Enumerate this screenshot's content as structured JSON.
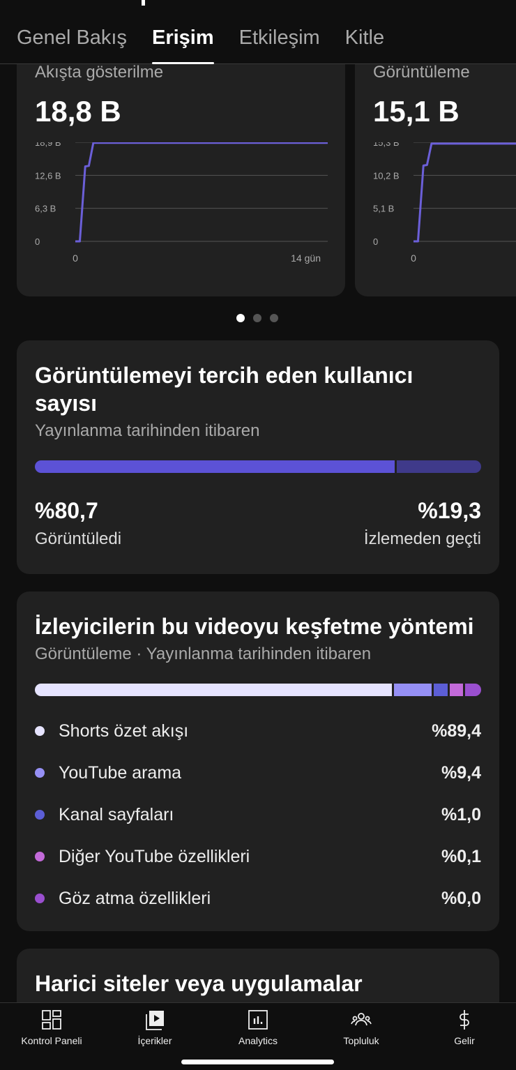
{
  "tabs": [
    {
      "label": "Genel Bakış"
    },
    {
      "label": "Erişim",
      "active": true
    },
    {
      "label": "Etkileşim"
    },
    {
      "label": "Kitle"
    }
  ],
  "chart_data": [
    {
      "type": "line",
      "title": "Akışta gösterilme",
      "value_label": "18,8 B",
      "yticks": [
        "0",
        "6,3 B",
        "12,6 B",
        "18,9 B"
      ],
      "ytick_values": [
        0,
        6.3,
        12.6,
        18.9
      ],
      "xticks": [
        "0",
        "14 gün"
      ],
      "xtick_values": [
        0,
        14
      ],
      "ylim": [
        0,
        18.9
      ],
      "xlim": [
        0,
        14
      ],
      "grid": true,
      "color": "#6b5fd8",
      "x": [
        0,
        0.25,
        0.55,
        0.75,
        1.0,
        14
      ],
      "y": [
        0,
        0,
        14.3,
        14.4,
        18.8,
        18.8
      ]
    },
    {
      "type": "line",
      "title": "Görüntüleme",
      "value_label": "15,1 B",
      "yticks": [
        "0",
        "5,1 B",
        "10,2 B",
        "15,3 B"
      ],
      "ytick_values": [
        0,
        5.1,
        10.2,
        15.3
      ],
      "xticks": [
        "0"
      ],
      "xtick_values": [
        0
      ],
      "ylim": [
        0,
        15.3
      ],
      "xlim": [
        0,
        14
      ],
      "grid": true,
      "color": "#6b5fd8",
      "x": [
        0,
        0.25,
        0.55,
        0.75,
        1.0,
        14
      ],
      "y": [
        0,
        0,
        11.7,
        11.8,
        15.1,
        15.1
      ]
    }
  ],
  "carousel": {
    "count": 3,
    "active": 0
  },
  "preference": {
    "title": "Görüntülemeyi tercih eden kullanıcı sayısı",
    "subtitle": "Yayınlanma tarihinden itibaren",
    "viewed_pct": 80.7,
    "viewed_value": "%80,7",
    "viewed_label": "Görüntüledi",
    "skipped_value": "%19,3",
    "skipped_label": "İzlemeden geçti",
    "colors": {
      "viewed": "#5c52d6",
      "skipped": "#3f3a8a"
    }
  },
  "discovery": {
    "title": "İzleyicilerin bu videoyu keşfetme yöntemi",
    "subtitle": "Görüntüleme · Yayınlanma tarihinden itibaren",
    "items": [
      {
        "label": "Shorts özet akışı",
        "value": "%89,4",
        "pct": 89.4,
        "color": "#e6e4ff"
      },
      {
        "label": "YouTube arama",
        "value": "%9,4",
        "pct": 9.4,
        "color": "#9690f5"
      },
      {
        "label": "Kanal sayfaları",
        "value": "%1,0",
        "pct": 1.0,
        "color": "#5c5ed6"
      },
      {
        "label": "Diğer YouTube özellikleri",
        "value": "%0,1",
        "pct": 0.1,
        "color": "#c36ad9"
      },
      {
        "label": "Göz atma özellikleri",
        "value": "%0,0",
        "pct": 0.0,
        "color": "#9a4fcf"
      }
    ]
  },
  "external": {
    "title": "Harici siteler veya uygulamalar"
  },
  "nav": [
    {
      "label": "Kontrol Paneli",
      "icon": "dashboard-icon"
    },
    {
      "label": "İçerikler",
      "icon": "content-icon"
    },
    {
      "label": "Analytics",
      "icon": "analytics-icon"
    },
    {
      "label": "Topluluk",
      "icon": "community-icon"
    },
    {
      "label": "Gelir",
      "icon": "dollar-icon"
    }
  ]
}
